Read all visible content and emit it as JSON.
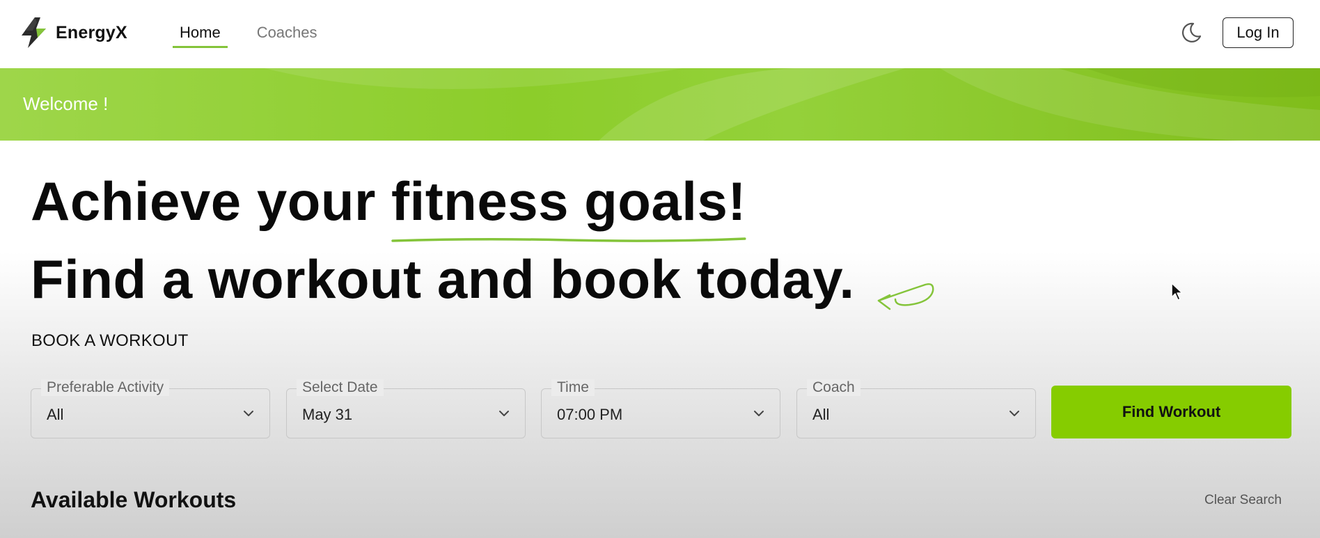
{
  "header": {
    "brand": "EnergyX",
    "nav": [
      {
        "label": "Home",
        "active": true
      },
      {
        "label": "Coaches",
        "active": false
      }
    ],
    "login_label": "Log In",
    "icons": {
      "logo": "lightning-bolt-icon",
      "theme": "moon-icon"
    }
  },
  "banner": {
    "text": "Welcome !"
  },
  "hero": {
    "line1_prefix": "Achieve your ",
    "line1_highlight": "fitness goals!",
    "line2": "Find a workout and book today."
  },
  "booking": {
    "section_label": "BOOK A WORKOUT",
    "fields": [
      {
        "label": "Preferable Activity",
        "value": "All"
      },
      {
        "label": "Select Date",
        "value": "May 31"
      },
      {
        "label": "Time",
        "value": "07:00 PM"
      },
      {
        "label": "Coach",
        "value": "All"
      }
    ],
    "find_button": "Find Workout"
  },
  "available": {
    "title": "Available Workouts",
    "clear_label": "Clear Search"
  },
  "colors": {
    "accent": "#86cc00",
    "banner": "#8ccd2a",
    "underline": "#84c43a"
  }
}
